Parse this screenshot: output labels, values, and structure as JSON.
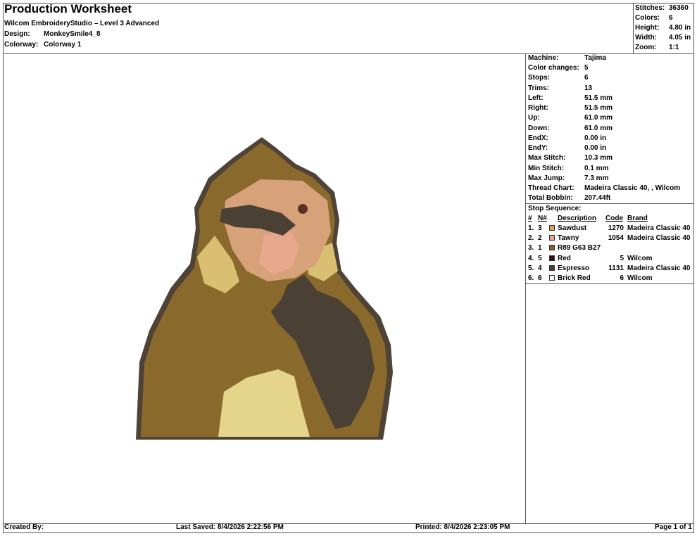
{
  "header": {
    "title": "Production Worksheet",
    "software": "Wilcom EmbroideryStudio – Level 3 Advanced",
    "design_label": "Design:",
    "design_value": "MonkeySmile4_8",
    "colorway_label": "Colorway:",
    "colorway_value": "Colorway 1"
  },
  "summary": [
    {
      "label": "Stitches:",
      "value": "36360"
    },
    {
      "label": "Colors:",
      "value": "6"
    },
    {
      "label": "Height:",
      "value": "4.80 in"
    },
    {
      "label": "Width:",
      "value": "4.05 in"
    },
    {
      "label": "Zoom:",
      "value": "1:1"
    }
  ],
  "details": [
    {
      "label": "Machine:",
      "value": "Tajima"
    },
    {
      "label": "Color changes:",
      "value": "5"
    },
    {
      "label": "Stops:",
      "value": "6"
    },
    {
      "label": "Trims:",
      "value": "13"
    },
    {
      "label": "Left:",
      "value": "51.5 mm"
    },
    {
      "label": "Right:",
      "value": "51.5 mm"
    },
    {
      "label": "Up:",
      "value": "61.0 mm"
    },
    {
      "label": "Down:",
      "value": "61.0 mm"
    },
    {
      "label": "EndX:",
      "value": "0.00 in"
    },
    {
      "label": "EndY:",
      "value": "0.00 in"
    },
    {
      "label": "Max Stitch:",
      "value": "10.3 mm"
    },
    {
      "label": "Min Stitch:",
      "value": "0.1 mm"
    },
    {
      "label": "Max Jump:",
      "value": "7.3 mm"
    },
    {
      "label": "Thread Chart:",
      "value": "Madeira Classic 40, , Wilcom"
    },
    {
      "label": "Total Bobbin:",
      "value": "207.44ft"
    }
  ],
  "stop_sequence": {
    "title": "Stop Sequence:",
    "headers": {
      "index": "#",
      "needle": "N#",
      "description": "Description",
      "code": "Code",
      "brand": "Brand"
    },
    "rows": [
      {
        "index": "1.",
        "needle": "3",
        "color": "#d9a35e",
        "description": "Sawdust",
        "code": "1270",
        "brand": "Madeira Classic 40"
      },
      {
        "index": "2.",
        "needle": "2",
        "color": "#f0a090",
        "description": "Tawny",
        "code": "1054",
        "brand": "Madeira Classic 40"
      },
      {
        "index": "3.",
        "needle": "1",
        "color": "#8a5c2a",
        "description": "R89 G63 B27",
        "code": "",
        "brand": ""
      },
      {
        "index": "4.",
        "needle": "5",
        "color": "#3a0a08",
        "description": "Red",
        "code": "5",
        "brand": "Wilcom"
      },
      {
        "index": "5.",
        "needle": "4",
        "color": "#4a3a30",
        "description": "Espresso",
        "code": "1131",
        "brand": "Madeira Classic 40"
      },
      {
        "index": "6.",
        "needle": "6",
        "color": "#ffffff",
        "description": "Brick Red",
        "code": "6",
        "brand": "Wilcom"
      }
    ]
  },
  "footer": {
    "created_by": "Created By:",
    "last_saved": "Last Saved: 8/4/2026 2:22:56 PM",
    "printed": "Printed: 8/4/2026 2:23:05 PM",
    "page": "Page 1 of 1"
  },
  "design_colors": {
    "outline": "#4e4336",
    "body": "#8a6a2c",
    "light": "#e4d58a",
    "face": "#e8a88e",
    "dark": "#4a4034"
  }
}
